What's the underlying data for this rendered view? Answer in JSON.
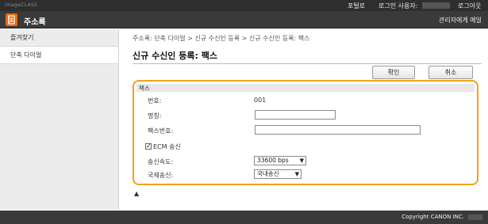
{
  "topbar": {
    "device": "imageCLASS",
    "portal": "포털로",
    "login_user": "로그인 사용자:",
    "logout": "로그아웃"
  },
  "header": {
    "title": "주소록",
    "admin_link": "관리자에게 메일"
  },
  "sidebar": {
    "items": [
      {
        "label": "즐겨찾기"
      },
      {
        "label": "단축 다이얼"
      }
    ]
  },
  "main": {
    "breadcrumb": "주소록: 단축 다이얼 > 신규 수신인 등록 > 신규 수신인 등록: 팩스",
    "page_title": "신규 수신인 등록: 팩스",
    "ok_label": "확인",
    "cancel_label": "취소"
  },
  "form": {
    "section": "팩스",
    "number_label": "번호:",
    "number_value": "001",
    "name_label": "명칭:",
    "name_value": "",
    "fax_label": "팩스번호:",
    "fax_value": "",
    "ecm_label": "ECM 송신",
    "ecm_checked": true,
    "speed_label": "송신속도:",
    "speed_value": "33600 bps",
    "intl_label": "국제송신:",
    "intl_value": "국내송신"
  },
  "footer": {
    "copyright": "Copyright CANON INC."
  }
}
